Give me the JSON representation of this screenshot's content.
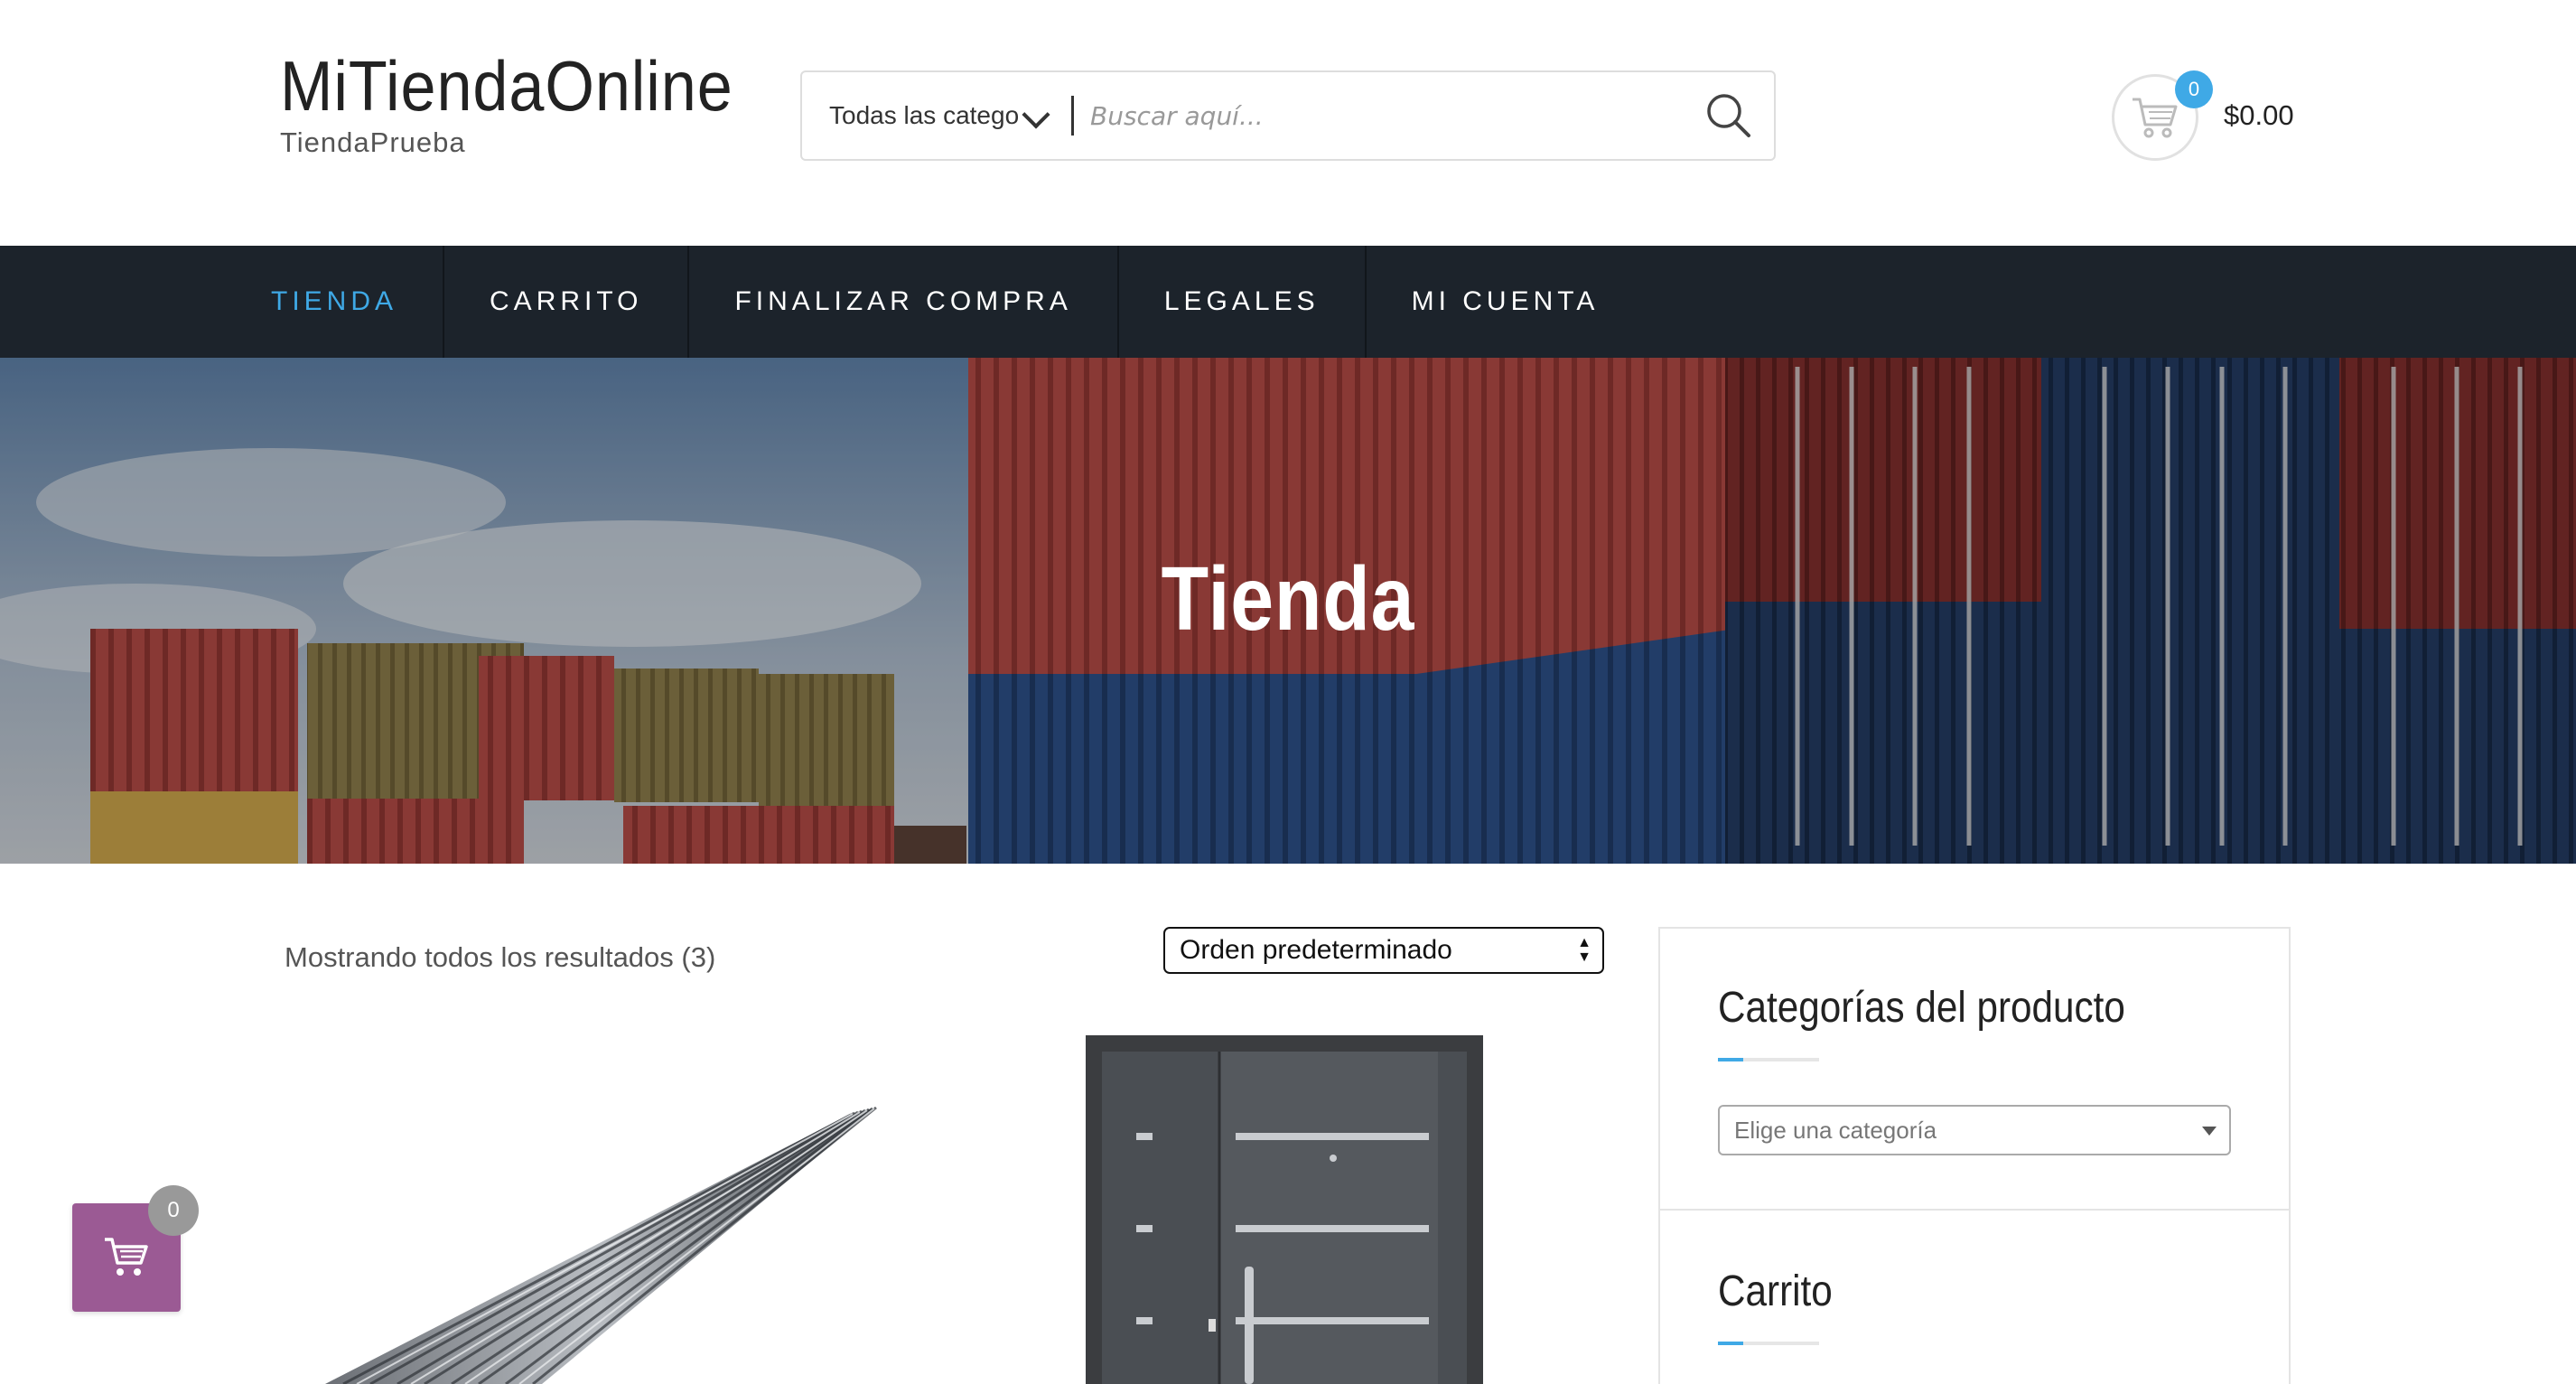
{
  "site": {
    "title": "MiTiendaOnline",
    "tagline": "TiendaPrueba"
  },
  "search": {
    "category_label": "Todas las catego",
    "placeholder": "Buscar aquí..."
  },
  "header_cart": {
    "count": "0",
    "total": "$0.00"
  },
  "nav": {
    "items": [
      {
        "label": "TIENDA",
        "active": true
      },
      {
        "label": "CARRITO"
      },
      {
        "label": "FINALIZAR COMPRA"
      },
      {
        "label": "LEGALES"
      },
      {
        "label": "MI CUENTA"
      }
    ]
  },
  "hero": {
    "title": "Tienda"
  },
  "shop": {
    "result_count": "Mostrando todos los resultados (3)",
    "orderby": "Orden predeterminado"
  },
  "sidebar": {
    "categories_title": "Categorías del producto",
    "categories_placeholder": "Elige una categoría",
    "cart_title": "Carrito"
  },
  "floating_cart": {
    "count": "0"
  },
  "colors": {
    "accent": "#3fa9e6",
    "nav_bg": "#1c232b",
    "floating_cart": "#9b5a94"
  }
}
